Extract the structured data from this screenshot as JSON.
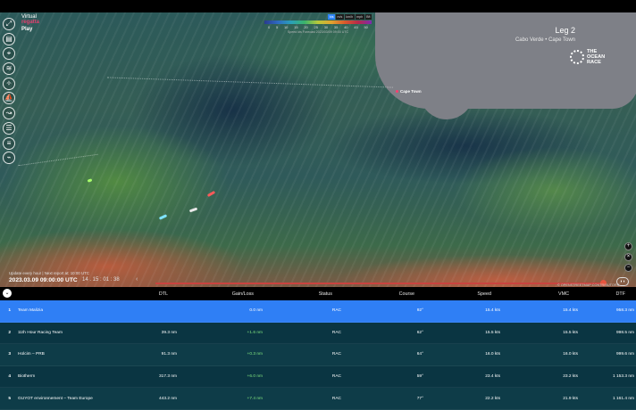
{
  "app": {
    "brand_logo_line1": "Virtual",
    "brand_logo_line2": "regatta",
    "brand_play": "Play"
  },
  "sidebar": {
    "items": [
      {
        "icon": "fullscreen-icon",
        "glyph": "⤢"
      },
      {
        "icon": "layers-icon",
        "glyph": "▤"
      },
      {
        "icon": "center-target-icon",
        "glyph": "⌖"
      },
      {
        "icon": "wind-icon",
        "glyph": "≋"
      },
      {
        "icon": "compass-icon",
        "glyph": "✧"
      },
      {
        "icon": "boat-icon",
        "glyph": "⛵"
      },
      {
        "icon": "tracks-icon",
        "glyph": "↝"
      },
      {
        "icon": "ranking-icon",
        "glyph": "☰"
      },
      {
        "icon": "list-icon",
        "glyph": "≡"
      },
      {
        "icon": "chart-icon",
        "glyph": "⌁"
      }
    ]
  },
  "legend": {
    "units": [
      "kts",
      "m/s",
      "km/h",
      "mph",
      "Bft"
    ],
    "active_unit": "kts",
    "ticks": [
      "0",
      "5",
      "10",
      "15",
      "20",
      "25",
      "30",
      "35",
      "40",
      "45",
      "50"
    ],
    "note": "Speed kts   Forecast 2023/03/09 09:00 UTC"
  },
  "leg": {
    "title": "Leg 2",
    "route": "Cabo Verde • Cape Town"
  },
  "ocean_race": {
    "line1": "THE",
    "line2": "OCEAN",
    "line3": "RACE"
  },
  "map": {
    "city_label": "Cape Town",
    "boat_colors": [
      "#ff5a5a",
      "#e9e9e9",
      "#7fe3ff",
      "#a9ff6b",
      "#2f86ff"
    ]
  },
  "timeline": {
    "update_note": "Update every hour | Next report at: 10:00 UTC",
    "timestamp": "2023.03.09 09:00:00 UTC",
    "elapsed": "14 . 15 : 01 : 38",
    "attribution": "© OPENSTREETMAP CONTRIBUTORS"
  },
  "map_controls": {
    "zoom_in_icon": "+",
    "zoom_out_icon": "−",
    "close_icon": "×"
  },
  "table": {
    "headers": {
      "dtl": "DTL",
      "gain": "Gain/Loss",
      "status": "Status",
      "course": "Course",
      "speed": "Speed",
      "vmc": "VMC",
      "dtf": "DTF"
    },
    "rows": [
      {
        "rank": "1",
        "team": "Team Malizia",
        "dtl": "",
        "gain": "0.0 nm",
        "status": "RAC",
        "course": "92°",
        "speed": "15.4 kts",
        "vmc": "15.4 kts",
        "dtf": "958.3 nm"
      },
      {
        "rank": "2",
        "team": "11th Hour Racing Team",
        "dtl": "39.3 nm",
        "gain": "+1.6 nm",
        "status": "RAC",
        "course": "62°",
        "speed": "15.5 kts",
        "vmc": "15.5 kts",
        "dtf": "998.5 nm"
      },
      {
        "rank": "3",
        "team": "Holcim – PRB",
        "dtl": "91.3 nm",
        "gain": "+0.3 nm",
        "status": "RAC",
        "course": "64°",
        "speed": "16.0 kts",
        "vmc": "16.0 kts",
        "dtf": "999.6 nm"
      },
      {
        "rank": "4",
        "team": "Biotherm",
        "dtl": "317.3 nm",
        "gain": "+6.0 nm",
        "status": "RAC",
        "course": "59°",
        "speed": "23.4 kts",
        "vmc": "23.2 kts",
        "dtf": "1 153.3 nm"
      },
      {
        "rank": "5",
        "team": "GUYOT environnement – Team Europe",
        "dtl": "443.2 nm",
        "gain": "+7.4 nm",
        "status": "RAC",
        "course": "77°",
        "speed": "22.2 kts",
        "vmc": "21.9 kts",
        "dtf": "1 161.4 nm"
      }
    ]
  }
}
